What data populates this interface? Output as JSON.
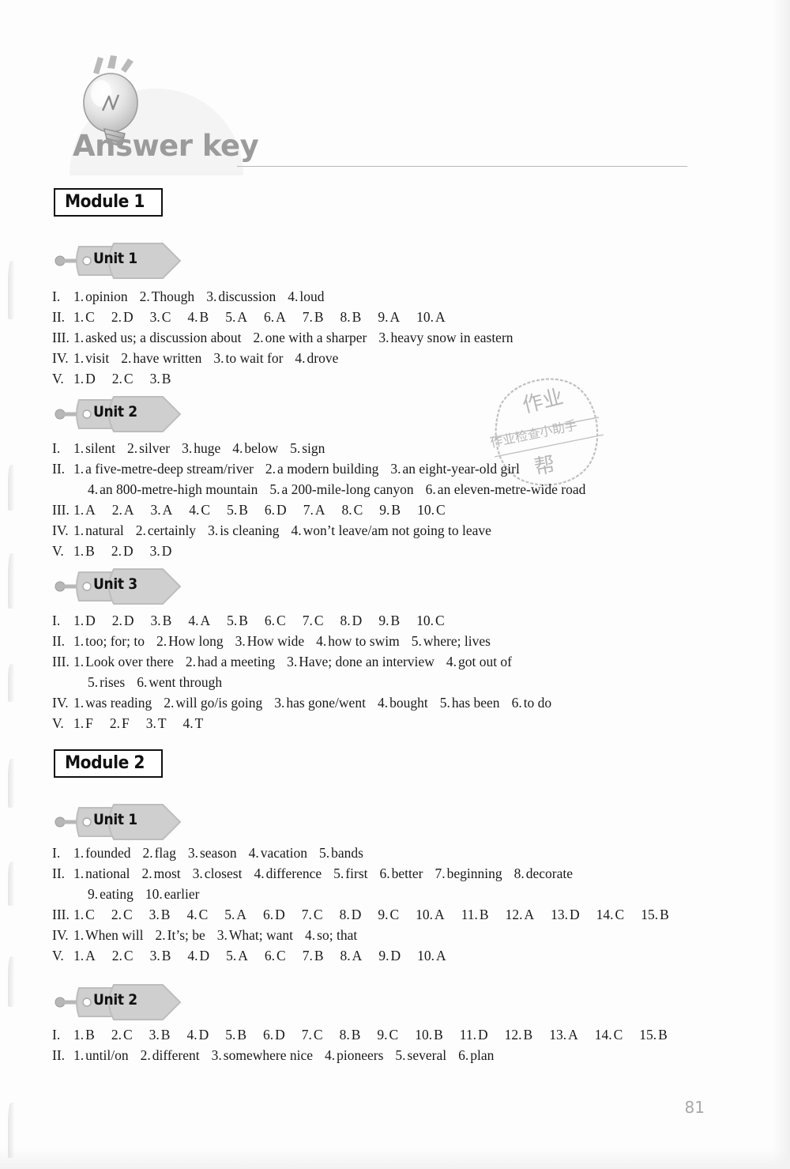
{
  "header": {
    "title": "Answer key",
    "bulb_icon": "lightbulb-icon"
  },
  "page_number": "81",
  "watermark": {
    "top_text": "作业",
    "band_text": "作业检查小助手",
    "bottom_text": "帮"
  },
  "modules": [
    {
      "label": "Module 1",
      "units": [
        {
          "label": "Unit 1",
          "rows": [
            {
              "numeral": "I.",
              "items": [
                {
                  "n": "1.",
                  "t": "opinion"
                },
                {
                  "n": "2.",
                  "t": "Though"
                },
                {
                  "n": "3.",
                  "t": "discussion"
                },
                {
                  "n": "4.",
                  "t": "loud"
                }
              ]
            },
            {
              "numeral": "II.",
              "choices": true,
              "items": [
                {
                  "n": "1.",
                  "t": "C"
                },
                {
                  "n": "2.",
                  "t": "D"
                },
                {
                  "n": "3.",
                  "t": "C"
                },
                {
                  "n": "4.",
                  "t": "B"
                },
                {
                  "n": "5.",
                  "t": "A"
                },
                {
                  "n": "6.",
                  "t": "A"
                },
                {
                  "n": "7.",
                  "t": "B"
                },
                {
                  "n": "8.",
                  "t": "B"
                },
                {
                  "n": "9.",
                  "t": "A"
                },
                {
                  "n": "10.",
                  "t": "A"
                }
              ]
            },
            {
              "numeral": "III.",
              "items": [
                {
                  "n": "1.",
                  "t": "asked us; a discussion about"
                },
                {
                  "n": "2.",
                  "t": "one with a sharper"
                },
                {
                  "n": "3.",
                  "t": "heavy snow in eastern"
                }
              ]
            },
            {
              "numeral": "IV.",
              "items": [
                {
                  "n": "1.",
                  "t": "visit"
                },
                {
                  "n": "2.",
                  "t": "have written"
                },
                {
                  "n": "3.",
                  "t": "to wait for"
                },
                {
                  "n": "4.",
                  "t": "drove"
                }
              ]
            },
            {
              "numeral": "V.",
              "choices": true,
              "items": [
                {
                  "n": "1.",
                  "t": "D"
                },
                {
                  "n": "2.",
                  "t": "C"
                },
                {
                  "n": "3.",
                  "t": "B"
                }
              ]
            }
          ]
        },
        {
          "label": "Unit 2",
          "rows": [
            {
              "numeral": "I.",
              "items": [
                {
                  "n": "1.",
                  "t": "silent"
                },
                {
                  "n": "2.",
                  "t": "silver"
                },
                {
                  "n": "3.",
                  "t": "huge"
                },
                {
                  "n": "4.",
                  "t": "below"
                },
                {
                  "n": "5.",
                  "t": "sign"
                }
              ]
            },
            {
              "numeral": "II.",
              "items": [
                {
                  "n": "1.",
                  "t": "a five-metre-deep stream/river"
                },
                {
                  "n": "2.",
                  "t": "a modern building"
                },
                {
                  "n": "3.",
                  "t": "an eight-year-old girl"
                }
              ]
            },
            {
              "numeral": "",
              "continuation": true,
              "items": [
                {
                  "n": "4.",
                  "t": "an 800-metre-high mountain"
                },
                {
                  "n": "5.",
                  "t": "a 200-mile-long canyon"
                },
                {
                  "n": "6.",
                  "t": "an eleven-metre-wide road"
                }
              ]
            },
            {
              "numeral": "III.",
              "choices": true,
              "items": [
                {
                  "n": "1.",
                  "t": "A"
                },
                {
                  "n": "2.",
                  "t": "A"
                },
                {
                  "n": "3.",
                  "t": "A"
                },
                {
                  "n": "4.",
                  "t": "C"
                },
                {
                  "n": "5.",
                  "t": "B"
                },
                {
                  "n": "6.",
                  "t": "D"
                },
                {
                  "n": "7.",
                  "t": "A"
                },
                {
                  "n": "8.",
                  "t": "C"
                },
                {
                  "n": "9.",
                  "t": "B"
                },
                {
                  "n": "10.",
                  "t": "C"
                }
              ]
            },
            {
              "numeral": "IV.",
              "items": [
                {
                  "n": "1.",
                  "t": "natural"
                },
                {
                  "n": "2.",
                  "t": "certainly"
                },
                {
                  "n": "3.",
                  "t": "is cleaning"
                },
                {
                  "n": "4.",
                  "t": "won’t leave/am not going to leave"
                }
              ]
            },
            {
              "numeral": "V.",
              "choices": true,
              "items": [
                {
                  "n": "1.",
                  "t": "B"
                },
                {
                  "n": "2.",
                  "t": "D"
                },
                {
                  "n": "3.",
                  "t": "D"
                }
              ]
            }
          ]
        },
        {
          "label": "Unit 3",
          "rows": [
            {
              "numeral": "I.",
              "choices": true,
              "items": [
                {
                  "n": "1.",
                  "t": "D"
                },
                {
                  "n": "2.",
                  "t": "D"
                },
                {
                  "n": "3.",
                  "t": "B"
                },
                {
                  "n": "4.",
                  "t": "A"
                },
                {
                  "n": "5.",
                  "t": "B"
                },
                {
                  "n": "6.",
                  "t": "C"
                },
                {
                  "n": "7.",
                  "t": "C"
                },
                {
                  "n": "8.",
                  "t": "D"
                },
                {
                  "n": "9.",
                  "t": "B"
                },
                {
                  "n": "10.",
                  "t": "C"
                }
              ]
            },
            {
              "numeral": "II.",
              "items": [
                {
                  "n": "1.",
                  "t": "too; for; to"
                },
                {
                  "n": "2.",
                  "t": "How long"
                },
                {
                  "n": "3.",
                  "t": "How wide"
                },
                {
                  "n": "4.",
                  "t": "how to swim"
                },
                {
                  "n": "5.",
                  "t": "where; lives"
                }
              ]
            },
            {
              "numeral": "III.",
              "items": [
                {
                  "n": "1.",
                  "t": "Look over there"
                },
                {
                  "n": "2.",
                  "t": "had a meeting"
                },
                {
                  "n": "3.",
                  "t": "Have; done an interview"
                },
                {
                  "n": "4.",
                  "t": "got out of"
                }
              ]
            },
            {
              "numeral": "",
              "continuation": true,
              "items": [
                {
                  "n": "5.",
                  "t": "rises"
                },
                {
                  "n": "6.",
                  "t": "went through"
                }
              ]
            },
            {
              "numeral": "IV.",
              "items": [
                {
                  "n": "1.",
                  "t": "was reading"
                },
                {
                  "n": "2.",
                  "t": "will go/is going"
                },
                {
                  "n": "3.",
                  "t": "has gone/went"
                },
                {
                  "n": "4.",
                  "t": "bought"
                },
                {
                  "n": "5.",
                  "t": "has been"
                },
                {
                  "n": "6.",
                  "t": "to do"
                }
              ]
            },
            {
              "numeral": "V.",
              "choices": true,
              "items": [
                {
                  "n": "1.",
                  "t": "F"
                },
                {
                  "n": "2.",
                  "t": "F"
                },
                {
                  "n": "3.",
                  "t": "T"
                },
                {
                  "n": "4.",
                  "t": "T"
                }
              ]
            }
          ]
        }
      ]
    },
    {
      "label": "Module 2",
      "units": [
        {
          "label": "Unit 1",
          "rows": [
            {
              "numeral": "I.",
              "items": [
                {
                  "n": "1.",
                  "t": "founded"
                },
                {
                  "n": "2.",
                  "t": "flag"
                },
                {
                  "n": "3.",
                  "t": "season"
                },
                {
                  "n": "4.",
                  "t": "vacation"
                },
                {
                  "n": "5.",
                  "t": "bands"
                }
              ]
            },
            {
              "numeral": "II.",
              "items": [
                {
                  "n": "1.",
                  "t": "national"
                },
                {
                  "n": "2.",
                  "t": "most"
                },
                {
                  "n": "3.",
                  "t": "closest"
                },
                {
                  "n": "4.",
                  "t": "difference"
                },
                {
                  "n": "5.",
                  "t": "first"
                },
                {
                  "n": "6.",
                  "t": "better"
                },
                {
                  "n": "7.",
                  "t": "beginning"
                },
                {
                  "n": "8.",
                  "t": "decorate"
                }
              ]
            },
            {
              "numeral": "",
              "continuation": true,
              "items": [
                {
                  "n": "9.",
                  "t": "eating"
                },
                {
                  "n": "10.",
                  "t": "earlier"
                }
              ]
            },
            {
              "numeral": "III.",
              "choices": true,
              "items": [
                {
                  "n": "1.",
                  "t": "C"
                },
                {
                  "n": "2.",
                  "t": "C"
                },
                {
                  "n": "3.",
                  "t": "B"
                },
                {
                  "n": "4.",
                  "t": "C"
                },
                {
                  "n": "5.",
                  "t": "A"
                },
                {
                  "n": "6.",
                  "t": "D"
                },
                {
                  "n": "7.",
                  "t": "C"
                },
                {
                  "n": "8.",
                  "t": "D"
                },
                {
                  "n": "9.",
                  "t": "C"
                },
                {
                  "n": "10.",
                  "t": "A"
                },
                {
                  "n": "11.",
                  "t": "B"
                },
                {
                  "n": "12.",
                  "t": "A"
                },
                {
                  "n": "13.",
                  "t": "D"
                },
                {
                  "n": "14.",
                  "t": "C"
                },
                {
                  "n": "15.",
                  "t": "B"
                }
              ]
            },
            {
              "numeral": "IV.",
              "items": [
                {
                  "n": "1.",
                  "t": "When will"
                },
                {
                  "n": "2.",
                  "t": "It’s; be"
                },
                {
                  "n": "3.",
                  "t": "What; want"
                },
                {
                  "n": "4.",
                  "t": "so; that"
                }
              ]
            },
            {
              "numeral": "V.",
              "choices": true,
              "items": [
                {
                  "n": "1.",
                  "t": "A"
                },
                {
                  "n": "2.",
                  "t": "C"
                },
                {
                  "n": "3.",
                  "t": "B"
                },
                {
                  "n": "4.",
                  "t": "D"
                },
                {
                  "n": "5.",
                  "t": "A"
                },
                {
                  "n": "6.",
                  "t": "C"
                },
                {
                  "n": "7.",
                  "t": "B"
                },
                {
                  "n": "8.",
                  "t": "A"
                },
                {
                  "n": "9.",
                  "t": "D"
                },
                {
                  "n": "10.",
                  "t": "A"
                }
              ]
            }
          ]
        },
        {
          "label": "Unit 2",
          "rows": [
            {
              "numeral": "I.",
              "choices": true,
              "items": [
                {
                  "n": "1.",
                  "t": "B"
                },
                {
                  "n": "2.",
                  "t": "C"
                },
                {
                  "n": "3.",
                  "t": "B"
                },
                {
                  "n": "4.",
                  "t": "D"
                },
                {
                  "n": "5.",
                  "t": "B"
                },
                {
                  "n": "6.",
                  "t": "D"
                },
                {
                  "n": "7.",
                  "t": "C"
                },
                {
                  "n": "8.",
                  "t": "B"
                },
                {
                  "n": "9.",
                  "t": "C"
                },
                {
                  "n": "10.",
                  "t": "B"
                },
                {
                  "n": "11.",
                  "t": "D"
                },
                {
                  "n": "12.",
                  "t": "B"
                },
                {
                  "n": "13.",
                  "t": "A"
                },
                {
                  "n": "14.",
                  "t": "C"
                },
                {
                  "n": "15.",
                  "t": "B"
                }
              ]
            },
            {
              "numeral": "II.",
              "items": [
                {
                  "n": "1.",
                  "t": "until/on"
                },
                {
                  "n": "2.",
                  "t": "different"
                },
                {
                  "n": "3.",
                  "t": "somewhere nice"
                },
                {
                  "n": "4.",
                  "t": "pioneers"
                },
                {
                  "n": "5.",
                  "t": "several"
                },
                {
                  "n": "6.",
                  "t": "plan"
                }
              ]
            }
          ]
        }
      ]
    }
  ]
}
